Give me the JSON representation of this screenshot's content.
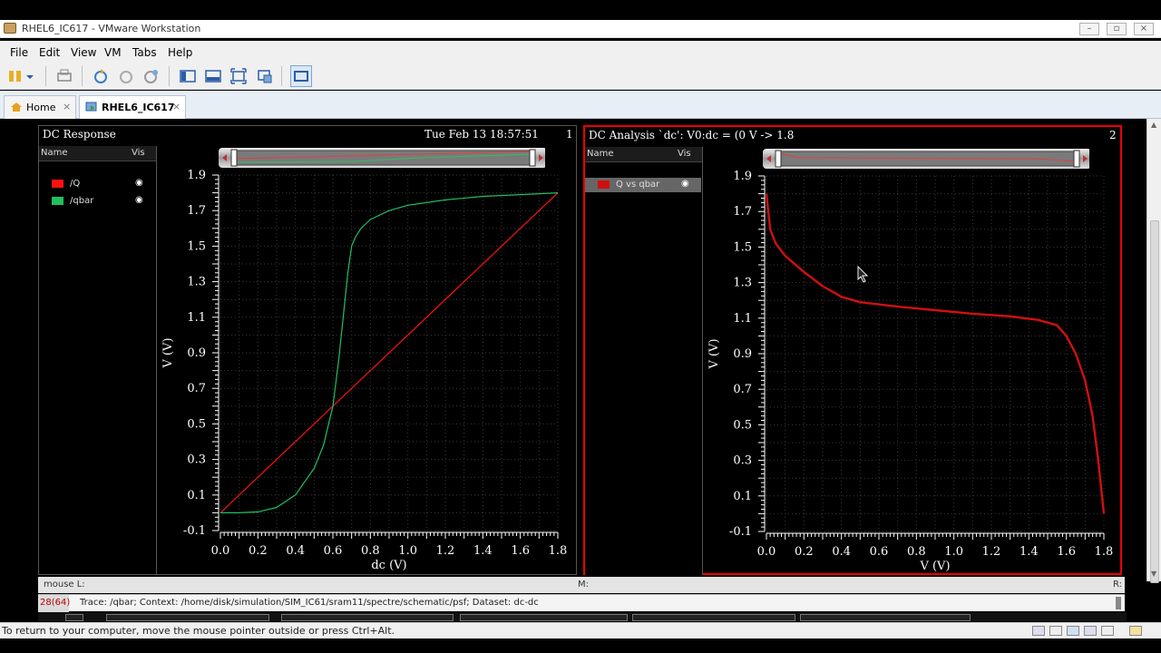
{
  "window": {
    "title": "RHEL6_IC617 - VMware Workstation"
  },
  "menu": [
    "File",
    "Edit",
    "View",
    "VM",
    "Tabs",
    "Help"
  ],
  "tabs": [
    {
      "label": "Home",
      "close": "×"
    },
    {
      "label": "RHEL6_IC617",
      "close": "×"
    }
  ],
  "left_panel": {
    "title": "DC Response",
    "date": "Tue Feb 13 18:57:51",
    "number": "1",
    "legend_header": {
      "name": "Name",
      "vis": "Vis"
    },
    "legend": [
      {
        "name": "/Q",
        "color": "#ff1010"
      },
      {
        "name": "/qbar",
        "color": "#20c060"
      }
    ]
  },
  "right_panel": {
    "title": "DC Analysis `dc': V0:dc = (0 V -> 1.8",
    "number": "2",
    "legend_header": {
      "name": "Name",
      "vis": "Vis"
    },
    "legend": [
      {
        "name": "Q vs qbar",
        "color": "#d01010"
      }
    ]
  },
  "chart_data": [
    {
      "type": "line",
      "xlabel": "dc (V)",
      "ylabel": "V (V)",
      "xlim": [
        0.0,
        1.8
      ],
      "ylim": [
        -0.1,
        1.9
      ],
      "xticks": [
        "0.0",
        "0.2",
        "0.4",
        "0.6",
        "0.8",
        "1.0",
        "1.2",
        "1.4",
        "1.6",
        "1.8"
      ],
      "yticks": [
        "1.9",
        "1.7",
        "1.5",
        "1.3",
        "1.1",
        "0.9",
        "0.7",
        "0.5",
        "0.3",
        "0.1",
        "-0.1"
      ],
      "series": [
        {
          "name": "/Q",
          "color": "#ff1010",
          "x": [
            0.0,
            1.8
          ],
          "y": [
            0.0,
            1.8
          ]
        },
        {
          "name": "/qbar",
          "color": "#20c060",
          "x": [
            0.0,
            0.1,
            0.2,
            0.3,
            0.4,
            0.5,
            0.55,
            0.6,
            0.63,
            0.66,
            0.68,
            0.7,
            0.72,
            0.75,
            0.8,
            0.9,
            1.0,
            1.2,
            1.4,
            1.6,
            1.8
          ],
          "y": [
            0.0,
            0.0,
            0.005,
            0.03,
            0.1,
            0.25,
            0.38,
            0.6,
            0.85,
            1.15,
            1.35,
            1.5,
            1.55,
            1.6,
            1.65,
            1.7,
            1.73,
            1.76,
            1.78,
            1.79,
            1.8
          ]
        }
      ]
    },
    {
      "type": "line",
      "xlabel": "V (V)",
      "ylabel": "V (V)",
      "xlim": [
        0.0,
        1.8
      ],
      "ylim": [
        -0.1,
        1.9
      ],
      "xticks": [
        "0.0",
        "0.2",
        "0.4",
        "0.6",
        "0.8",
        "1.0",
        "1.2",
        "1.4",
        "1.6",
        "1.8"
      ],
      "yticks": [
        "1.9",
        "1.7",
        "1.5",
        "1.3",
        "1.1",
        "0.9",
        "0.7",
        "0.5",
        "0.3",
        "0.1",
        "-0.1"
      ],
      "series": [
        {
          "name": "Q vs qbar",
          "color": "#d01010",
          "x": [
            0.0,
            0.01,
            0.02,
            0.05,
            0.1,
            0.2,
            0.3,
            0.4,
            0.5,
            0.7,
            0.9,
            1.1,
            1.3,
            1.45,
            1.55,
            1.6,
            1.65,
            1.7,
            1.74,
            1.77,
            1.79,
            1.8
          ],
          "y": [
            1.8,
            1.7,
            1.6,
            1.52,
            1.45,
            1.36,
            1.28,
            1.22,
            1.19,
            1.165,
            1.145,
            1.125,
            1.11,
            1.09,
            1.06,
            1.0,
            0.9,
            0.75,
            0.55,
            0.3,
            0.1,
            0.0
          ]
        }
      ]
    }
  ],
  "status1": {
    "left": "mouse L:",
    "middle": "M:",
    "right": "R:"
  },
  "status2": {
    "count": "28(64)",
    "trace": "Trace: /qbar; Context: /home/disk/simulation/SIM_IC61/sram11/spectre/schematic/psf; Dataset: dc-dc"
  },
  "bottom_message": "To return to your computer, move the mouse pointer outside or press Ctrl+Alt."
}
